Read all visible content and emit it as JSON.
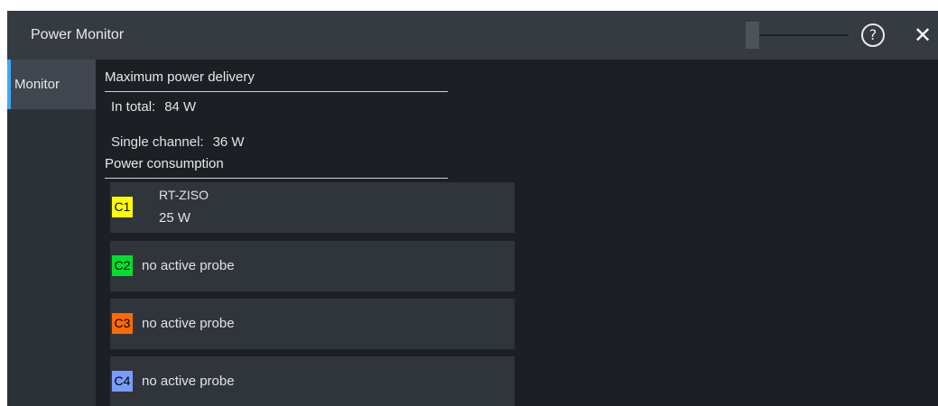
{
  "window": {
    "title": "Power Monitor",
    "slider_value": 0,
    "help_icon": "?",
    "close_icon": "✕"
  },
  "sidebar": {
    "tabs": [
      {
        "label": "Monitor",
        "active": true
      }
    ]
  },
  "monitor": {
    "max_delivery": {
      "heading": "Maximum power delivery",
      "total_label": "In total:",
      "total_value": "84 W",
      "single_label": "Single channel:",
      "single_value": "36 W"
    },
    "consumption": {
      "heading": "Power consumption",
      "channels": [
        {
          "id": "C1",
          "color": "#ffff00",
          "text_color": "#000000",
          "probe": "RT-ZISO",
          "power": "25 W"
        },
        {
          "id": "C2",
          "color": "#00e02a",
          "text_color": "#000000",
          "status": "no active probe"
        },
        {
          "id": "C3",
          "color": "#ff6a00",
          "text_color": "#000000",
          "status": "no active probe"
        },
        {
          "id": "C4",
          "color": "#7a9cff",
          "text_color": "#000000",
          "status": "no active probe"
        }
      ]
    }
  },
  "theme": {
    "accent": "#3da9f5",
    "background": "#1c2024",
    "titlebar": "#363b41",
    "card": "#30353b"
  }
}
